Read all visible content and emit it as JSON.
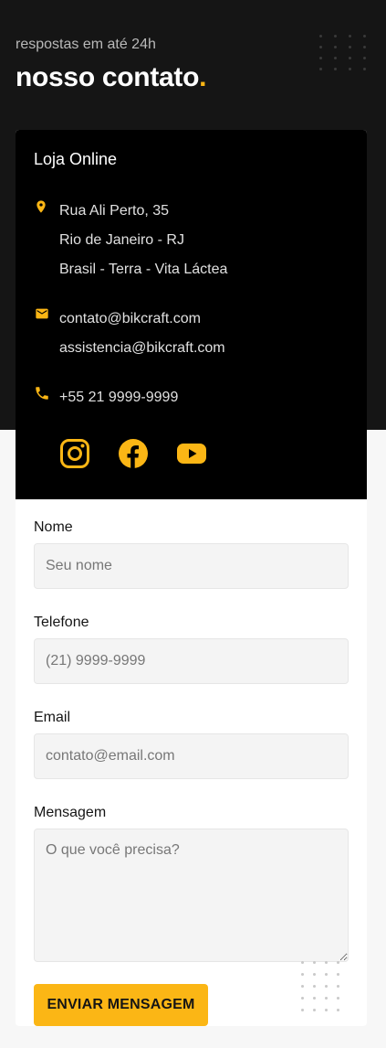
{
  "header": {
    "subtitle": "respostas em até 24h",
    "title": "nosso contato",
    "title_dot": "."
  },
  "info": {
    "heading": "Loja Online",
    "address": [
      "Rua Ali Perto, 35",
      "Rio de Janeiro - RJ",
      "Brasil - Terra - Vita Láctea"
    ],
    "emails": [
      "contato@bikcraft.com",
      "assistencia@bikcraft.com"
    ],
    "phone": "+55 21 9999-9999",
    "icons": [
      "location-pin-icon",
      "mail-icon",
      "phone-icon"
    ],
    "social": [
      "instagram-icon",
      "facebook-icon",
      "youtube-icon"
    ]
  },
  "form": {
    "name_label": "Nome",
    "name_placeholder": "Seu nome",
    "phone_label": "Telefone",
    "phone_placeholder": "(21) 9999-9999",
    "email_label": "Email",
    "email_placeholder": "contato@email.com",
    "message_label": "Mensagem",
    "message_placeholder": "O que você precisa?",
    "submit_label": "Enviar Mensagem"
  },
  "colors": {
    "accent": "#fbb615",
    "dark": "#151515",
    "card_dark": "#000000",
    "page_bg": "#f7f7f7"
  }
}
